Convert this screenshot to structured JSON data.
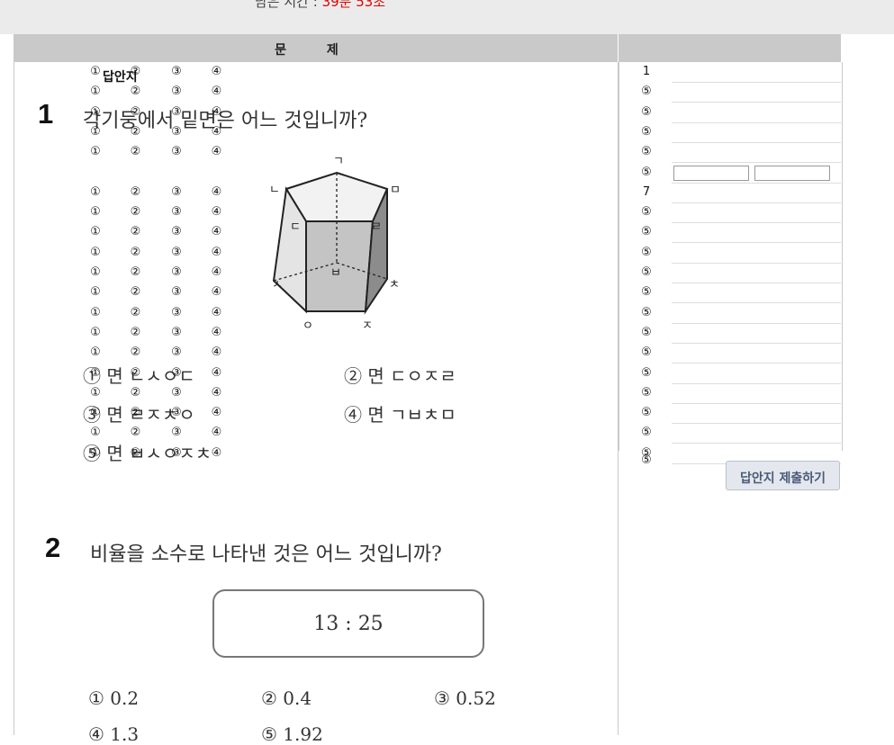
{
  "timer": {
    "label": "남은 시간 : ",
    "value": "39분 53초"
  },
  "question_header": "문 제",
  "answer_sheet_label": "답안지",
  "questions": [
    {
      "number": "1",
      "text": "각기둥에서 밑면은 어느 것입니까?",
      "figure_labels": [
        "ㄱ",
        "ㄴ",
        "ㄷ",
        "ㄹ",
        "ㅁ",
        "ㅂ",
        "ㅅ",
        "ㅇ",
        "ㅈ",
        "ㅊ"
      ],
      "choices": [
        "① 면 ㄴㅅㅇㄷ",
        "② 면 ㄷㅇㅈㄹ",
        "③ 면 ㄹㅈㅊㅇ",
        "④ 면 ㄱㅂㅊㅁ",
        "⑤ 면 ㅂㅅㅇㅈㅊ"
      ]
    },
    {
      "number": "2",
      "text": "비율을 소수로 나타낸 것은 어느 것입니까?",
      "ratio": "13 : 25",
      "choices": [
        "① 0.2",
        "② 0.4",
        "③ 0.52",
        "④ 1.3",
        "⑤ 1.92"
      ]
    }
  ],
  "answer_sheet": {
    "options": [
      "①",
      "②",
      "③",
      "④"
    ],
    "rows": [
      {
        "num": "1",
        "type": "choice"
      },
      {
        "num": "⑤",
        "type": "choice"
      },
      {
        "num": "⑤",
        "type": "choice"
      },
      {
        "num": "⑤",
        "type": "choice"
      },
      {
        "num": "⑤",
        "type": "choice"
      },
      {
        "num": "⑤",
        "type": "text"
      },
      {
        "num": "7",
        "type": "choice"
      },
      {
        "num": "⑤",
        "type": "choice"
      },
      {
        "num": "⑤",
        "type": "choice"
      },
      {
        "num": "⑤",
        "type": "choice"
      },
      {
        "num": "⑤",
        "type": "choice"
      },
      {
        "num": "⑤",
        "type": "choice"
      },
      {
        "num": "⑤",
        "type": "choice"
      },
      {
        "num": "⑤",
        "type": "choice"
      },
      {
        "num": "⑤",
        "type": "choice"
      },
      {
        "num": "⑤",
        "type": "choice"
      },
      {
        "num": "⑤",
        "type": "choice"
      },
      {
        "num": "⑤",
        "type": "choice"
      },
      {
        "num": "⑤",
        "type": "choice"
      },
      {
        "num": "⑤",
        "type": "choice"
      }
    ],
    "last_marker": "⑤",
    "submit_label": "답안지 제출하기"
  },
  "colors": {
    "timer_value": "#e00000",
    "header_bg": "#c9c9c9",
    "topbar_bg": "#ebebeb"
  }
}
